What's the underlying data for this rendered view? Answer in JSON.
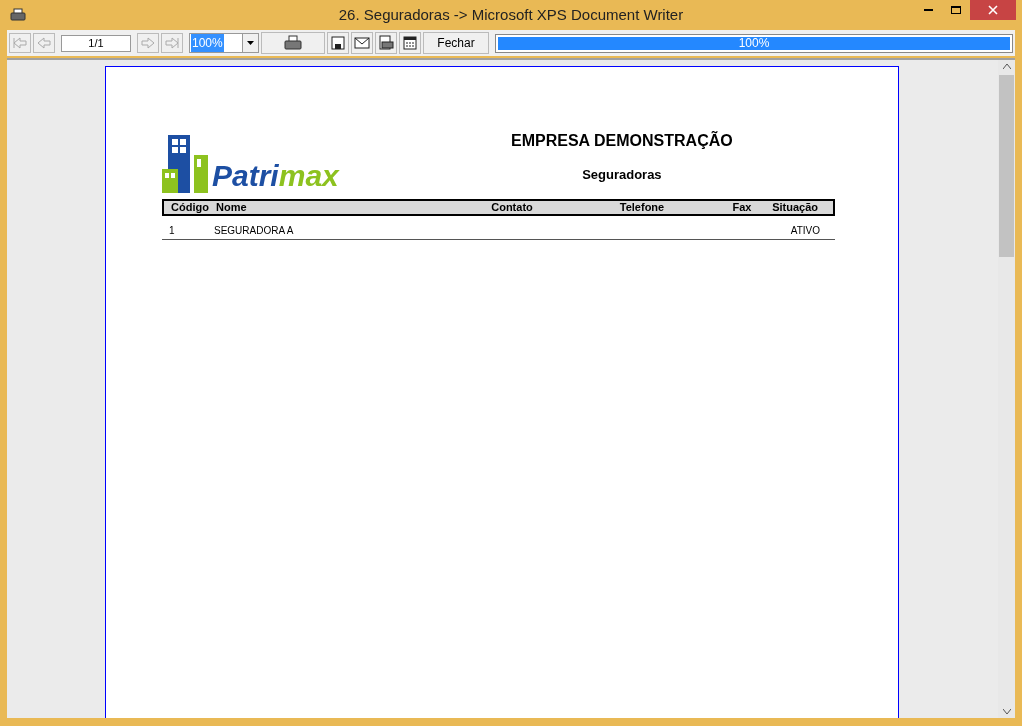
{
  "window": {
    "title": "26. Seguradoras -> Microsoft XPS Document Writer"
  },
  "toolbar": {
    "page_field": "1/1",
    "zoom_field": "100%",
    "close_button": "Fechar",
    "progress": {
      "level": 1,
      "reading": "100%"
    }
  },
  "report": {
    "logo": {
      "text_primary": "Patri",
      "text_accent": "max"
    },
    "company": "EMPRESA DEMONSTRAÇÃO",
    "title": "Seguradoras",
    "columns": [
      "Código",
      "Nome",
      "Contato",
      "Telefone",
      "Fax",
      "Situação"
    ],
    "rows": [
      [
        "1",
        "SEGURADORA A",
        "",
        "",
        "",
        "ATIVO"
      ]
    ]
  }
}
